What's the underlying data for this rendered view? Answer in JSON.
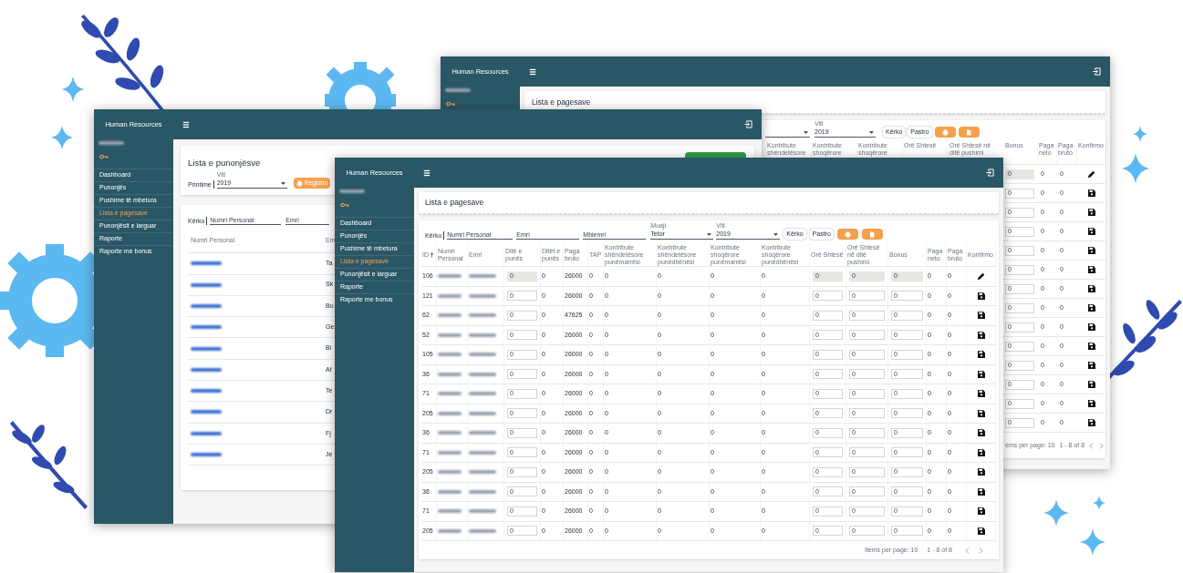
{
  "back_window": {
    "app_title": "Human Resources",
    "page_title": "Lista e pagesave",
    "year_select": {
      "label": "Viti",
      "value": "2019"
    },
    "buttons": [
      {
        "kind": "text",
        "label": "Kërko"
      },
      {
        "kind": "text",
        "label": "Pastro"
      },
      {
        "kind": "print"
      },
      {
        "kind": "file"
      }
    ],
    "table": {
      "columns": [
        "Kontribute shëndetësore",
        "Kontribute shoqërore",
        "Kontribute shoqërore",
        "Orë Shtesë",
        "Orë Shtesë në ditë pushimi",
        "Bonus",
        "Paga neto",
        "Paga bruto",
        "Konfirmo"
      ],
      "rows": [
        {
          "bonus": "0",
          "locked": true,
          "net_pay": "0",
          "gross_total": "0",
          "kind": "edit"
        },
        {
          "bonus": "0",
          "locked": false,
          "net_pay": "0",
          "gross_total": "0",
          "kind": "save"
        },
        {
          "bonus": "0",
          "locked": false,
          "net_pay": "0",
          "gross_total": "0",
          "kind": "save"
        },
        {
          "bonus": "0",
          "locked": false,
          "net_pay": "0",
          "gross_total": "0",
          "kind": "save"
        },
        {
          "bonus": "0",
          "locked": false,
          "net_pay": "0",
          "gross_total": "0",
          "kind": "save"
        },
        {
          "bonus": "0",
          "locked": false,
          "net_pay": "0",
          "gross_total": "0",
          "kind": "save"
        },
        {
          "bonus": "0",
          "locked": false,
          "net_pay": "0",
          "gross_total": "0",
          "kind": "save"
        },
        {
          "bonus": "0",
          "locked": false,
          "net_pay": "0",
          "gross_total": "0",
          "kind": "save"
        },
        {
          "bonus": "0",
          "locked": false,
          "net_pay": "0",
          "gross_total": "0",
          "kind": "save"
        },
        {
          "bonus": "0",
          "locked": false,
          "net_pay": "0",
          "gross_total": "0",
          "kind": "save"
        },
        {
          "bonus": "0",
          "locked": false,
          "net_pay": "0",
          "gross_total": "0",
          "kind": "save"
        },
        {
          "bonus": "0",
          "locked": false,
          "net_pay": "0",
          "gross_total": "0",
          "kind": "save"
        },
        {
          "bonus": "0",
          "locked": false,
          "net_pay": "0",
          "gross_total": "0",
          "kind": "save"
        },
        {
          "bonus": "0",
          "locked": false,
          "net_pay": "0",
          "gross_total": "0",
          "kind": "save"
        }
      ]
    },
    "pagination": {
      "items_per_page": "ems per page: 10",
      "range": "1 - 8 of 8"
    }
  },
  "left_window": {
    "app_title": "Human Resources",
    "sidebar_items": [
      {
        "label": "Dashboard",
        "selected": false
      },
      {
        "label": "Punonjës",
        "selected": false
      },
      {
        "label": "Pushime të mbetura",
        "selected": false
      },
      {
        "label": "Lista e pagesave",
        "selected": true
      },
      {
        "label": "Punonjësit e larguar",
        "selected": false
      },
      {
        "label": "Raporte",
        "selected": false
      },
      {
        "label": "Raporte me bonus",
        "selected": false
      }
    ],
    "page_title": "Lista e punonjësve",
    "print_label": "Printime",
    "year_select": {
      "label": "Viti",
      "value": "2019"
    },
    "register_button": "Regjistro",
    "search_label": "Kërko",
    "search_fields": [
      {
        "placeholder": "Numri Personal"
      },
      {
        "placeholder": "Emri"
      }
    ],
    "table": {
      "columns": [
        "Numri Personal",
        "Em"
      ],
      "rows": [
        {
          "name": "Ta"
        },
        {
          "name": "Sk"
        },
        {
          "name": "Bu"
        },
        {
          "name": "Ge"
        },
        {
          "name": "Bl"
        },
        {
          "name": "Af"
        },
        {
          "name": "Te"
        },
        {
          "name": "Dr"
        },
        {
          "name": "Fj"
        },
        {
          "name": "Je"
        }
      ]
    }
  },
  "front_window": {
    "app_title": "Human Resources",
    "sidebar_items": [
      {
        "label": "Dashboard",
        "selected": false
      },
      {
        "label": "Punonjës",
        "selected": false
      },
      {
        "label": "Pushime të mbetura",
        "selected": false
      },
      {
        "label": "Lista e pagesave",
        "selected": true
      },
      {
        "label": "Punonjësit e larguar",
        "selected": false
      },
      {
        "label": "Raporte",
        "selected": false
      },
      {
        "label": "Raporte me bonus",
        "selected": false
      }
    ],
    "page_title": "Lista e pagesave",
    "search_label": "Kërko",
    "search_fields": [
      {
        "placeholder": "Numri Personal"
      },
      {
        "placeholder": "Emri"
      },
      {
        "placeholder": "Mbiemri"
      }
    ],
    "selects": [
      {
        "label": "Muaji",
        "value": "Tetor"
      },
      {
        "label": "Viti",
        "value": "2019"
      }
    ],
    "buttons": [
      {
        "kind": "text",
        "label": "Kërko"
      },
      {
        "kind": "text",
        "label": "Pastro"
      },
      {
        "kind": "print"
      },
      {
        "kind": "file"
      }
    ],
    "table": {
      "columns": [
        {
          "label": "ID",
          "sort_ascending": true
        },
        {
          "label": "Numri Personal"
        },
        {
          "label": "Emri"
        },
        {
          "label": "Ditë e punës"
        },
        {
          "label": "Ditët e punës"
        },
        {
          "label": "Paga bruto"
        },
        {
          "label": "TAP"
        },
        {
          "label": "Kontribute shëndetësore punëmarrësi"
        },
        {
          "label": "Kontribute shëndetësore punëdhënësi"
        },
        {
          "label": "Kontribute shoqërore punëmarrësi"
        },
        {
          "label": "Kontribute shoqërore punëdhënësi"
        },
        {
          "label": "Orë Shtesë"
        },
        {
          "label": "Orë Shtesë në ditë pushimi"
        },
        {
          "label": "Bonus"
        },
        {
          "label": "Paga neto"
        },
        {
          "label": "Paga bruto"
        },
        {
          "label": "Konfirmo"
        }
      ],
      "rows": [
        {
          "id": "106",
          "locked": true,
          "days_input": "0",
          "days": "0",
          "gross_pay": "26000",
          "tap": "0",
          "hc_employee": "0",
          "hc_employer": "0",
          "sc_employee": "0",
          "sc_employer": "0",
          "overtime": "0",
          "overtime_holiday": "0",
          "bonus": "0",
          "net_pay": "0",
          "gross_total": "0",
          "kind": "edit"
        },
        {
          "id": "121",
          "locked": false,
          "days_input": "0",
          "days": "0",
          "gross_pay": "26000",
          "tap": "0",
          "hc_employee": "0",
          "hc_employer": "0",
          "sc_employee": "0",
          "sc_employer": "0",
          "overtime": "0",
          "overtime_holiday": "0",
          "bonus": "0",
          "net_pay": "0",
          "gross_total": "0",
          "kind": "save"
        },
        {
          "id": "62",
          "locked": false,
          "days_input": "0",
          "days": "0",
          "gross_pay": "47625",
          "tap": "0",
          "hc_employee": "0",
          "hc_employer": "0",
          "sc_employee": "0",
          "sc_employer": "0",
          "overtime": "0",
          "overtime_holiday": "0",
          "bonus": "0",
          "net_pay": "0",
          "gross_total": "0",
          "kind": "save"
        },
        {
          "id": "52",
          "locked": false,
          "days_input": "0",
          "days": "0",
          "gross_pay": "26000",
          "tap": "0",
          "hc_employee": "0",
          "hc_employer": "0",
          "sc_employee": "0",
          "sc_employer": "0",
          "overtime": "0",
          "overtime_holiday": "0",
          "bonus": "0",
          "net_pay": "0",
          "gross_total": "0",
          "kind": "save"
        },
        {
          "id": "105",
          "locked": false,
          "days_input": "0",
          "days": "0",
          "gross_pay": "26000",
          "tap": "0",
          "hc_employee": "0",
          "hc_employer": "0",
          "sc_employee": "0",
          "sc_employer": "0",
          "overtime": "0",
          "overtime_holiday": "0",
          "bonus": "0",
          "net_pay": "0",
          "gross_total": "0",
          "kind": "save"
        },
        {
          "id": "36",
          "locked": false,
          "days_input": "0",
          "days": "0",
          "gross_pay": "26000",
          "tap": "0",
          "hc_employee": "0",
          "hc_employer": "0",
          "sc_employee": "0",
          "sc_employer": "0",
          "overtime": "0",
          "overtime_holiday": "0",
          "bonus": "0",
          "net_pay": "0",
          "gross_total": "0",
          "kind": "save"
        },
        {
          "id": "71",
          "locked": false,
          "days_input": "0",
          "days": "0",
          "gross_pay": "26000",
          "tap": "0",
          "hc_employee": "0",
          "hc_employer": "0",
          "sc_employee": "0",
          "sc_employer": "0",
          "overtime": "0",
          "overtime_holiday": "0",
          "bonus": "0",
          "net_pay": "0",
          "gross_total": "0",
          "kind": "save"
        },
        {
          "id": "205",
          "locked": false,
          "days_input": "0",
          "days": "0",
          "gross_pay": "26000",
          "tap": "0",
          "hc_employee": "0",
          "hc_employer": "0",
          "sc_employee": "0",
          "sc_employer": "0",
          "overtime": "0",
          "overtime_holiday": "0",
          "bonus": "0",
          "net_pay": "0",
          "gross_total": "0",
          "kind": "save"
        },
        {
          "id": "36",
          "locked": false,
          "days_input": "0",
          "days": "0",
          "gross_pay": "26000",
          "tap": "0",
          "hc_employee": "0",
          "hc_employer": "0",
          "sc_employee": "0",
          "sc_employer": "0",
          "overtime": "0",
          "overtime_holiday": "0",
          "bonus": "0",
          "net_pay": "0",
          "gross_total": "0",
          "kind": "save"
        },
        {
          "id": "71",
          "locked": false,
          "days_input": "0",
          "days": "0",
          "gross_pay": "26000",
          "tap": "0",
          "hc_employee": "0",
          "hc_employer": "0",
          "sc_employee": "0",
          "sc_employer": "0",
          "overtime": "0",
          "overtime_holiday": "0",
          "bonus": "0",
          "net_pay": "0",
          "gross_total": "0",
          "kind": "save"
        },
        {
          "id": "205",
          "locked": false,
          "days_input": "0",
          "days": "0",
          "gross_pay": "26000",
          "tap": "0",
          "hc_employee": "0",
          "hc_employer": "0",
          "sc_employee": "0",
          "sc_employer": "0",
          "overtime": "0",
          "overtime_holiday": "0",
          "bonus": "0",
          "net_pay": "0",
          "gross_total": "0",
          "kind": "save"
        },
        {
          "id": "36",
          "locked": false,
          "days_input": "0",
          "days": "0",
          "gross_pay": "26000",
          "tap": "0",
          "hc_employee": "0",
          "hc_employer": "0",
          "sc_employee": "0",
          "sc_employer": "0",
          "overtime": "0",
          "overtime_holiday": "0",
          "bonus": "0",
          "net_pay": "0",
          "gross_total": "0",
          "kind": "save"
        },
        {
          "id": "71",
          "locked": false,
          "days_input": "0",
          "days": "0",
          "gross_pay": "26000",
          "tap": "0",
          "hc_employee": "0",
          "hc_employer": "0",
          "sc_employee": "0",
          "sc_employer": "0",
          "overtime": "0",
          "overtime_holiday": "0",
          "bonus": "0",
          "net_pay": "0",
          "gross_total": "0",
          "kind": "save"
        },
        {
          "id": "205",
          "locked": false,
          "days_input": "0",
          "days": "0",
          "gross_pay": "26000",
          "tap": "0",
          "hc_employee": "0",
          "hc_employer": "0",
          "sc_employee": "0",
          "sc_employer": "0",
          "overtime": "0",
          "overtime_holiday": "0",
          "bonus": "0",
          "net_pay": "0",
          "gross_total": "0",
          "kind": "save"
        }
      ]
    },
    "pagination": {
      "items_per_page": "Items per page: 10",
      "range": "1 - 8 of 8"
    }
  }
}
